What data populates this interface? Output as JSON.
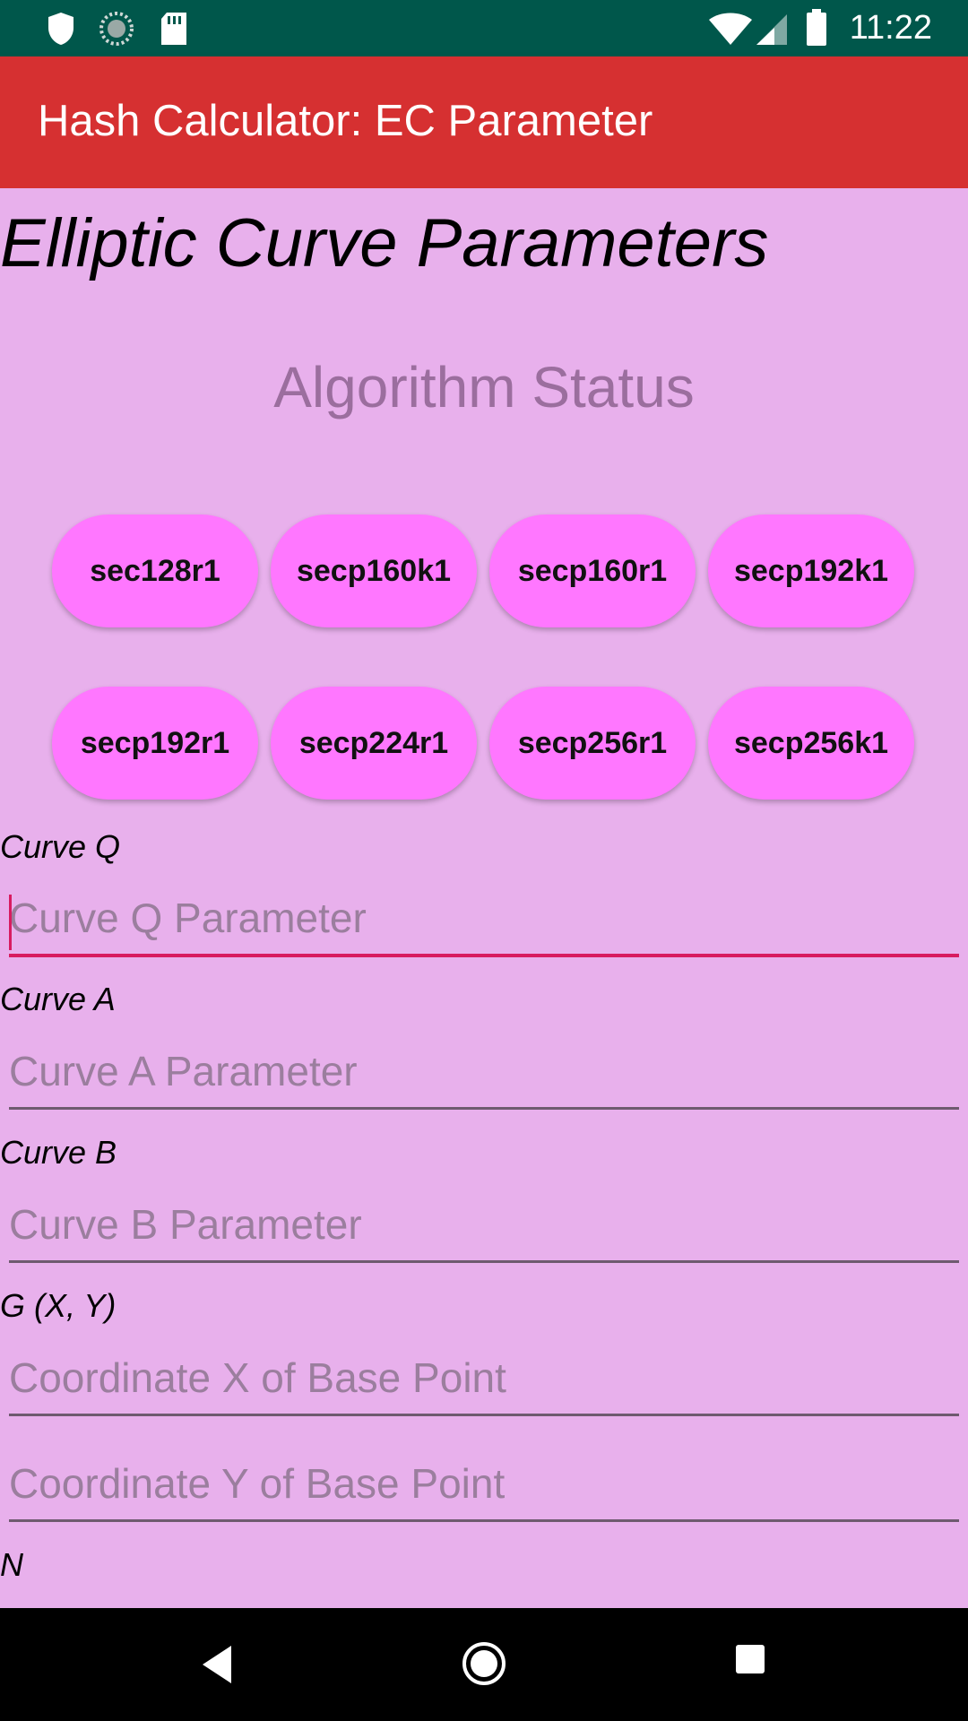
{
  "status_bar": {
    "time": "11:22",
    "icons": [
      "shield-icon",
      "sync-icon",
      "sd-card-icon",
      "wifi-icon",
      "signal-icon",
      "battery-icon"
    ]
  },
  "app_bar": {
    "title": "Hash Calculator: EC Parameter"
  },
  "main": {
    "heading": "Elliptic Curve Parameters",
    "algorithm_status": "Algorithm Status",
    "curve_buttons": [
      {
        "label": "sec128r1"
      },
      {
        "label": "secp160k1"
      },
      {
        "label": "secp160r1"
      },
      {
        "label": "secp192k1"
      },
      {
        "label": "secp192r1"
      },
      {
        "label": "secp224r1"
      },
      {
        "label": "secp256r1"
      },
      {
        "label": "secp256k1"
      }
    ],
    "fields": {
      "curve_q": {
        "label": "Curve Q",
        "placeholder": "Curve Q Parameter",
        "value": ""
      },
      "curve_a": {
        "label": "Curve A",
        "placeholder": "Curve A Parameter",
        "value": ""
      },
      "curve_b": {
        "label": "Curve B",
        "placeholder": "Curve B Parameter",
        "value": ""
      },
      "g": {
        "label": "G (X, Y)",
        "placeholder_x": "Coordinate X of Base Point",
        "placeholder_y": "Coordinate Y of Base Point"
      },
      "n": {
        "label": "N"
      }
    }
  },
  "nav_bar": {
    "buttons": [
      "back-icon",
      "home-icon",
      "recents-icon"
    ]
  },
  "colors": {
    "status_bar": "#00574B",
    "app_bar": "#D63031",
    "background": "#E8B0EC",
    "button": "#FF77FF",
    "accent": "#D81B60"
  }
}
